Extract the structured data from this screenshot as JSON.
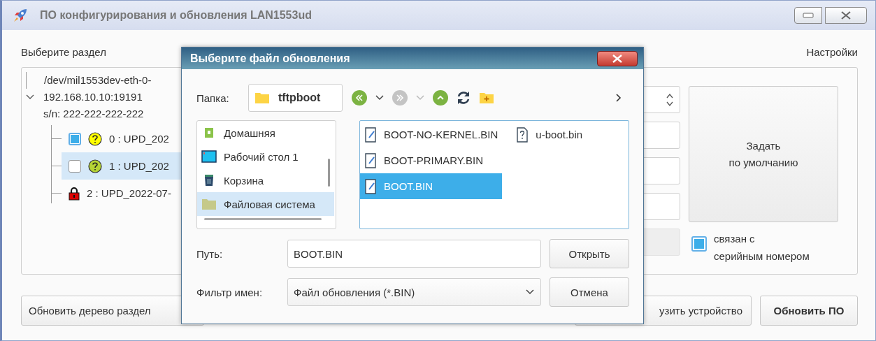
{
  "window": {
    "title": "ПО конфигурирования и обновления LAN1553ud"
  },
  "sections": {
    "label": "Выберите раздел",
    "tree": {
      "path": "/dev/mil1553dev-eth-0-",
      "address": "192.168.10.10:19191",
      "serial": "s/n: 222-222-222-222",
      "expanded": true,
      "children": [
        {
          "label": "0 : UPD_202",
          "kind": "question",
          "color": "#ffff00",
          "checked": true,
          "selected": false
        },
        {
          "label": "1 : UPD_202",
          "kind": "question",
          "color": "#b5d334",
          "checked": false,
          "selected": true
        },
        {
          "label": "2 : UPD_2022-07-",
          "kind": "locked",
          "selected": false
        }
      ]
    }
  },
  "settings": {
    "label": "Настройки",
    "default_button": [
      "Задать",
      "по умолчанию"
    ],
    "linked_checkbox": {
      "lines": [
        "связан с",
        "серийным номером"
      ],
      "checked": true
    }
  },
  "buttons": [
    {
      "label": "Обновить дерево раздел",
      "default": false
    },
    {
      "label": "узить устройство",
      "default": false
    },
    {
      "label": "Обновить ПО",
      "default": true
    }
  ],
  "dialog": {
    "title": "Выберите файл обновления",
    "folder_label": "Папка:",
    "folder": "tftpboot",
    "forward_enabled": false,
    "places": [
      {
        "label": "Домашняя",
        "kind": "home",
        "selected": false
      },
      {
        "label": "Рабочий стол 1",
        "kind": "desktop",
        "selected": false
      },
      {
        "label": "Корзина",
        "kind": "trash",
        "selected": false
      },
      {
        "label": "Файловая система",
        "kind": "folder",
        "selected": true
      }
    ],
    "files": [
      {
        "name": "BOOT-NO-KERNEL.BIN",
        "kind": "binary",
        "selected": false
      },
      {
        "name": "BOOT-PRIMARY.BIN",
        "kind": "binary",
        "selected": false
      },
      {
        "name": "BOOT.BIN",
        "kind": "binary",
        "selected": true
      },
      {
        "name": "u-boot.bin",
        "kind": "unknown",
        "selected": false
      }
    ],
    "path_label": "Путь:",
    "path": "BOOT.BIN",
    "filter_label": "Фильтр имен:",
    "filter": "Файл обновления (*.BIN)",
    "open_button": "Открыть",
    "cancel_button": "Отмена"
  }
}
